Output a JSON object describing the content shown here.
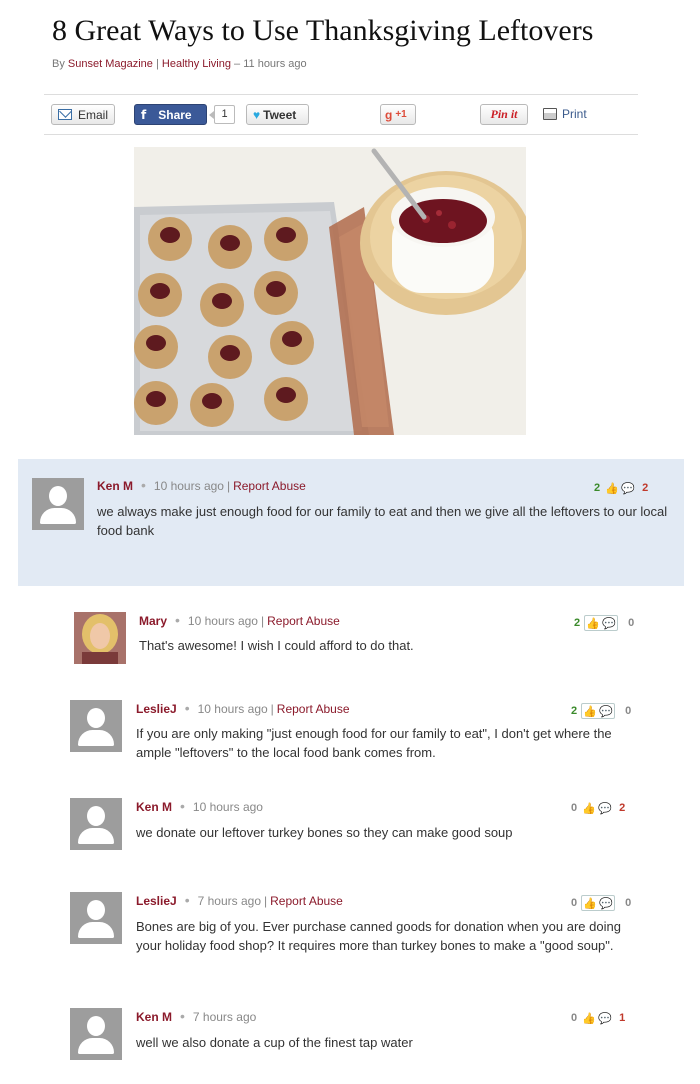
{
  "article": {
    "title": "8 Great Ways to Use Thanksgiving Leftovers",
    "byline_prefix": "By",
    "author": "Sunset Magazine",
    "byline_sep": "|",
    "category": "Healthy Living",
    "time": "– 11 hours ago"
  },
  "share": {
    "email": "Email",
    "fb_glyph": "f",
    "share": "Share",
    "share_count": "1",
    "tweet": "Tweet",
    "gplus": "+1",
    "gplus_glyph": "g",
    "pin": "Pin it",
    "print": "Print"
  },
  "comments": [
    {
      "name": "Ken M",
      "time": "10 hours ago",
      "report": "Report Abuse",
      "text": "we always make just enough food for our family to eat and then we give all the leftovers to our local food bank",
      "up": "2",
      "down": "2"
    },
    {
      "name": "Mary",
      "time": "10 hours ago",
      "report": "Report Abuse",
      "text": "That's awesome! I wish I could afford to do that.",
      "up": "2",
      "down": "0"
    },
    {
      "name": "LeslieJ",
      "time": "10 hours ago",
      "report": "Report Abuse",
      "text": "If you are only making \"just enough food for our family to eat\", I don't get where the ample \"leftovers\" to the local food bank comes from.",
      "up": "2",
      "down": "0"
    },
    {
      "name": "Ken M",
      "time": "10 hours ago",
      "report": "",
      "text": "we donate our leftover turkey bones so they can make good soup",
      "up": "0",
      "down": "2"
    },
    {
      "name": "LeslieJ",
      "time": "7 hours ago",
      "report": "Report Abuse",
      "text": "Bones are big of you. Ever purchase canned goods for donation when you are doing your holiday food shop? It requires more than turkey bones to make a \"good soup\".",
      "up": "0",
      "down": "0"
    },
    {
      "name": "Ken M",
      "time": "7 hours ago",
      "report": "",
      "text": "well we also donate a cup of the finest tap water",
      "up": "0",
      "down": "1"
    }
  ],
  "icons": {
    "thumbs_up": "👍",
    "reply": "💬"
  },
  "colors": {
    "link": "#8b1a2b",
    "highlight": "#e2eaf4",
    "facebook": "#3b5998"
  }
}
